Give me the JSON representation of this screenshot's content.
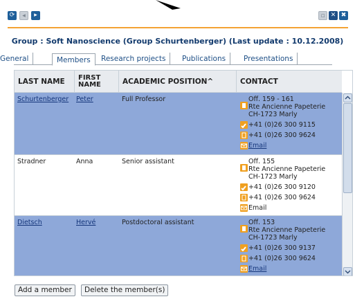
{
  "group": {
    "title": "Group : Soft Nanoscience (Group Schurtenberger) (Last update : 10.12.2008)"
  },
  "tabs": [
    {
      "label": "General"
    },
    {
      "label": "Members"
    },
    {
      "label": "Research projects"
    },
    {
      "label": "Publications"
    },
    {
      "label": "Presentations"
    }
  ],
  "table": {
    "headers": {
      "last_name": "LAST NAME",
      "first_name_1": "FIRST",
      "first_name_2": "NAME",
      "academic_position": "ACADEMIC POSITION^",
      "contact": "CONTACT"
    },
    "rows": [
      {
        "last_name": "Schurtenberger",
        "first_name": "Peter",
        "position": "Full Professor",
        "office": "Off. 159 - 161",
        "street": "Rte Ancienne Papeterie",
        "city": "CH-1723 Marly",
        "phone": "+41 (0)26 300 9115",
        "fax": "+41 (0)26 300 9624",
        "email": "Email"
      },
      {
        "last_name": "Stradner",
        "first_name": "Anna",
        "position": "Senior assistant",
        "office": "Off. 155",
        "street": "Rte Ancienne Papeterie",
        "city": "CH-1723 Marly",
        "phone": "+41 (0)26 300 9120",
        "fax": "+41 (0)26 300 9624",
        "email": "Email"
      },
      {
        "last_name": "Dietsch",
        "first_name": "Hervé",
        "position": "Postdoctoral assistant",
        "office": "Off. 153",
        "street": "Rte Ancienne Papeterie",
        "city": "CH-1723 Marly",
        "phone": "+41 (0)26 300 9137",
        "fax": "+41 (0)26 300 9624",
        "email": "Email"
      }
    ]
  },
  "buttons": {
    "add_member": "Add a member",
    "delete_member": "Delete the member(s)"
  },
  "colors": {
    "accent": "#f4a233",
    "selected_row": "#8ea8d9",
    "title_text": "#123a6d"
  },
  "icons": {
    "refresh": "refresh-icon",
    "prev": "arrow-left-icon",
    "next": "arrow-right-icon",
    "save": "save-icon",
    "tools": "tools-icon",
    "close": "close-icon",
    "address": "building-icon",
    "phone": "phone-icon",
    "fax": "fax-icon",
    "email": "envelope-icon"
  }
}
